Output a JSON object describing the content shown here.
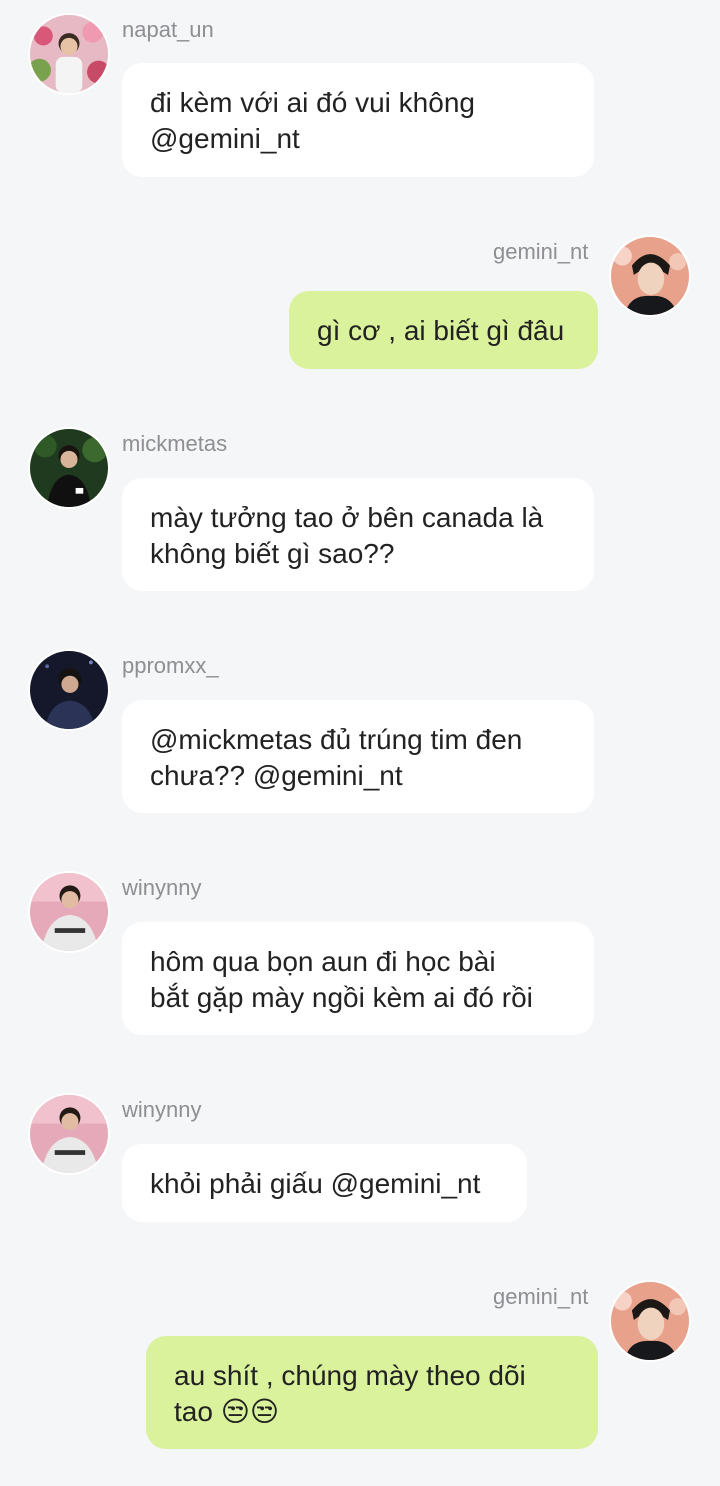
{
  "messages": [
    {
      "user": "napat_un",
      "lines": [
        "đi kèm với ai đó vui không",
        "@gemini_nt"
      ]
    },
    {
      "user": "gemini_nt",
      "lines": [
        "gì cơ , ai biết gì đâu"
      ]
    },
    {
      "user": "mickmetas",
      "lines": [
        "mày tưởng tao ở bên canada là",
        "không biết gì sao??"
      ]
    },
    {
      "user": "ppromxx_",
      "lines": [
        "@mickmetas đủ trúng tim đen",
        "chưa?? @gemini_nt"
      ]
    },
    {
      "user": "winynny",
      "lines": [
        "hôm qua bọn aun đi học bài",
        "bắt gặp mày ngồi kèm ai đó rồi"
      ]
    },
    {
      "user": "winynny",
      "lines": [
        "khỏi phải giấu @gemini_nt"
      ]
    },
    {
      "user": "gemini_nt",
      "lines": [
        "au shít , chúng mày theo dõi",
        "tao 😒😒"
      ]
    }
  ],
  "avatars": {
    "napat_un": "avatar-photo-flowers",
    "gemini_nt": "avatar-photo-dark-hair",
    "mickmetas": "avatar-photo-dark-green",
    "ppromxx_": "avatar-photo-night",
    "winynny": "avatar-photo-pink"
  },
  "colors": {
    "background": "#f5f6f8",
    "incoming_bubble": "#ffffff",
    "outgoing_bubble": "#d9f29b",
    "username": "#8e8e93",
    "text": "#222222"
  }
}
